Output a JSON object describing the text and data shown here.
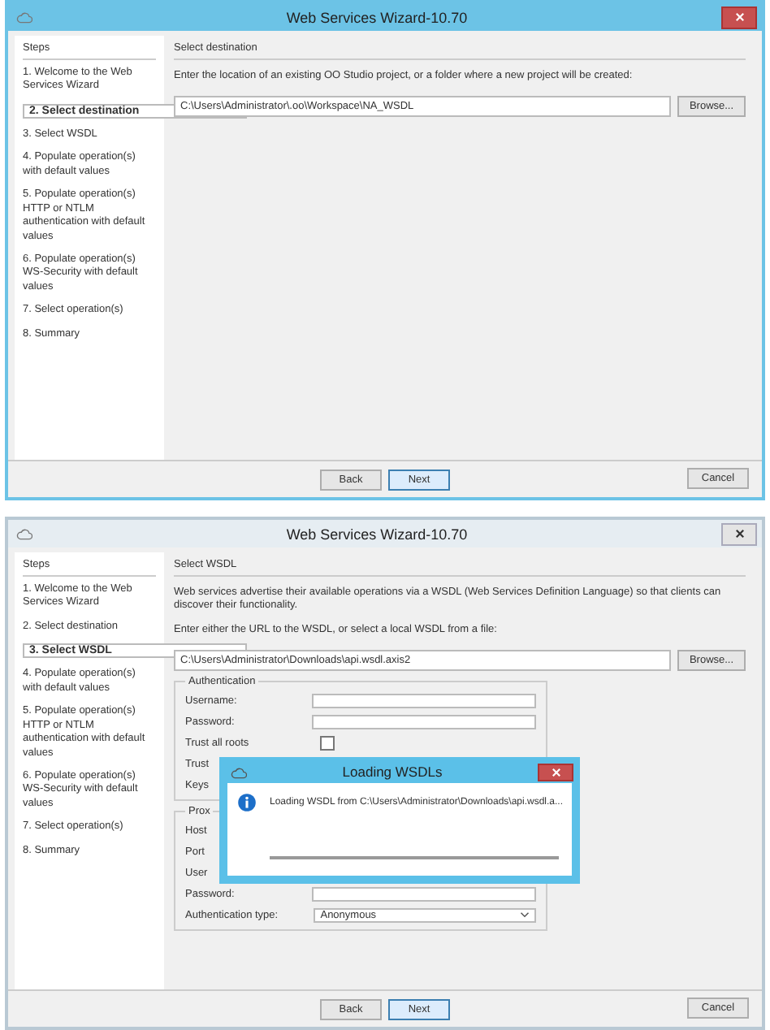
{
  "windows": [
    {
      "title": "Web Services Wizard-10.70",
      "close_highlighted": true,
      "steps_title": "Steps",
      "steps": [
        {
          "label": "1. Welcome to the Web Services Wizard",
          "selected": false
        },
        {
          "label": "2. Select destination",
          "selected": true
        },
        {
          "label": "3. Select WSDL",
          "selected": false
        },
        {
          "label": "4. Populate operation(s) with default values",
          "selected": false
        },
        {
          "label": "5. Populate operation(s) HTTP or NTLM authentication with default values",
          "selected": false
        },
        {
          "label": "6. Populate operation(s) WS-Security with default values",
          "selected": false
        },
        {
          "label": "7. Select operation(s)",
          "selected": false
        },
        {
          "label": "8. Summary",
          "selected": false
        }
      ],
      "section_title": "Select destination",
      "paragraphs": [
        "Enter the location of an existing OO Studio project, or a folder where a new project will be created:"
      ],
      "path": "C:\\Users\\Administrator\\.oo\\Workspace\\NA_WSDL",
      "browse": "Browse...",
      "buttons": [
        {
          "label": "Back",
          "kind": "normal"
        },
        {
          "label": "Next",
          "kind": "default"
        },
        {
          "label": "Cancel",
          "kind": "right"
        }
      ]
    },
    {
      "title": "Web Services Wizard-10.70",
      "close_highlighted": false,
      "steps_title": "Steps",
      "steps": [
        {
          "label": "1. Welcome to the Web Services Wizard",
          "selected": false
        },
        {
          "label": "2. Select destination",
          "selected": false
        },
        {
          "label": "3. Select WSDL",
          "selected": true
        },
        {
          "label": "4. Populate operation(s) with default values",
          "selected": false
        },
        {
          "label": "5. Populate operation(s) HTTP or NTLM authentication with default values",
          "selected": false
        },
        {
          "label": "6. Populate operation(s) WS-Security with default values",
          "selected": false
        },
        {
          "label": "7. Select operation(s)",
          "selected": false
        },
        {
          "label": "8. Summary",
          "selected": false
        }
      ],
      "section_title": "Select WSDL",
      "paragraphs": [
        "Web services advertise their available operations via a WSDL (Web Services Definition Language) so that clients can discover their functionality.",
        "Enter either the URL to the WSDL, or select a local WSDL from a file:"
      ],
      "path": "C:\\Users\\Administrator\\Downloads\\api.wsdl.axis2",
      "browse": "Browse...",
      "groups": [
        {
          "title": "Authentication",
          "fields": [
            {
              "label": "Username:",
              "kind": "text"
            },
            {
              "label": "Password:",
              "kind": "text"
            },
            {
              "label": "Trust all roots",
              "kind": "checkbox",
              "checked": false
            },
            {
              "label": "Trust",
              "kind": "label"
            },
            {
              "label": "Keys",
              "kind": "label"
            }
          ]
        },
        {
          "title": "Prox",
          "fields": [
            {
              "label": "Host",
              "kind": "label"
            },
            {
              "label": "Port",
              "kind": "label"
            },
            {
              "label": "User",
              "kind": "label"
            },
            {
              "label": "Password:",
              "kind": "text"
            },
            {
              "label": "Authentication type:",
              "kind": "select",
              "value": "Anonymous"
            }
          ]
        }
      ],
      "dialog": {
        "title": "Loading WSDLs",
        "message": "Loading WSDL from C:\\Users\\Administrator\\Downloads\\api.wsdl.a..."
      },
      "buttons": [
        {
          "label": "Back",
          "kind": "normal"
        },
        {
          "label": "Next",
          "kind": "default"
        },
        {
          "label": "Cancel",
          "kind": "right"
        }
      ]
    }
  ]
}
